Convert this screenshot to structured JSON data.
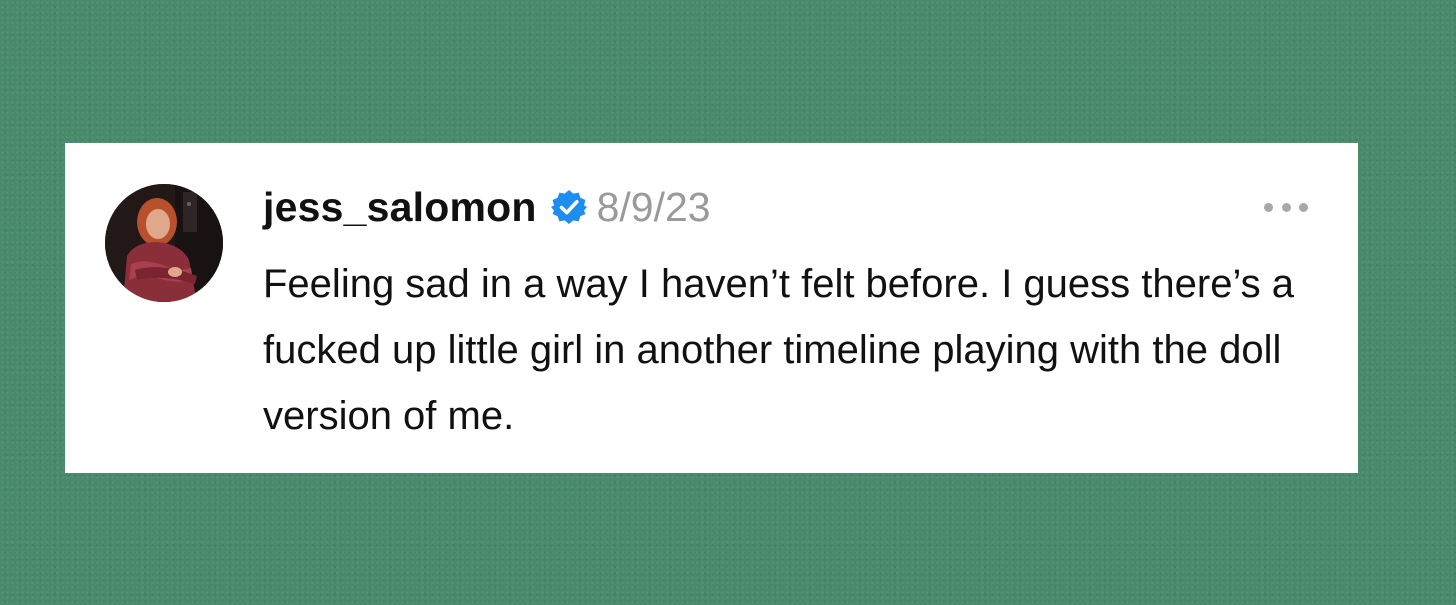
{
  "background_color": "#4a8a6c",
  "post": {
    "username": "jess_salomon",
    "verified": true,
    "verified_color": "#1d8ef0",
    "date": "8/9/23",
    "more_icon": "ellipsis-icon",
    "avatar_icon": "profile-avatar",
    "text": "Feeling sad in a way I haven’t felt before. I guess there’s a fucked up little girl in another timeline playing with the doll version of me."
  }
}
